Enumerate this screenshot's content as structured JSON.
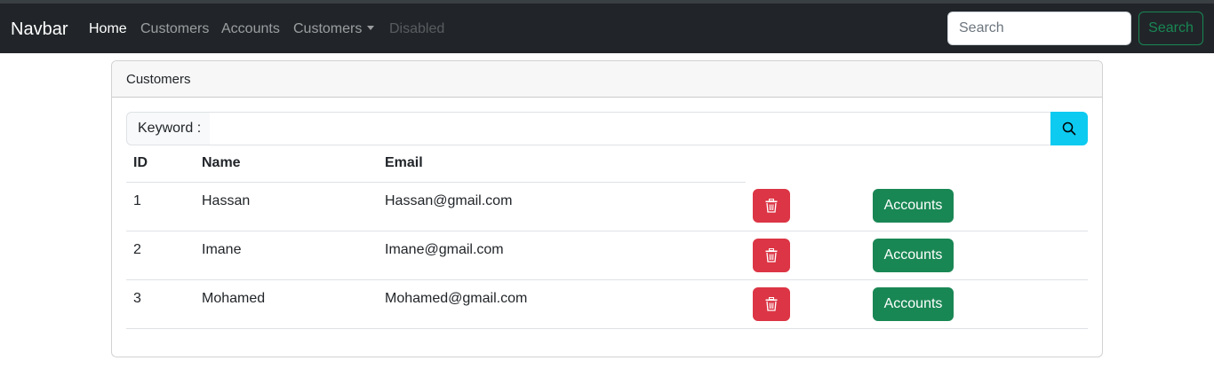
{
  "navbar": {
    "brand": "Navbar",
    "links": [
      {
        "label": "Home",
        "state": "active"
      },
      {
        "label": "Customers",
        "state": "normal"
      },
      {
        "label": "Accounts",
        "state": "normal"
      },
      {
        "label": "Customers",
        "state": "dropdown"
      },
      {
        "label": "Disabled",
        "state": "disabled"
      }
    ],
    "search_placeholder": "Search",
    "search_button": "Search"
  },
  "card": {
    "header": "Customers",
    "keyword_label": "Keyword :",
    "keyword_value": "",
    "search_icon": "search-icon",
    "columns": [
      "ID",
      "Name",
      "Email"
    ],
    "rows": [
      {
        "id": "1",
        "name": "Hassan",
        "email": "Hassan@gmail.com",
        "delete_icon": "trash-icon",
        "accounts_label": "Accounts"
      },
      {
        "id": "2",
        "name": "Imane",
        "email": "Imane@gmail.com",
        "delete_icon": "trash-icon",
        "accounts_label": "Accounts"
      },
      {
        "id": "3",
        "name": "Mohamed",
        "email": "Mohamed@gmail.com",
        "delete_icon": "trash-icon",
        "accounts_label": "Accounts"
      }
    ]
  },
  "colors": {
    "navbar_bg": "#212529",
    "success": "#198754",
    "danger": "#dc3545",
    "info": "#0dcaf0"
  }
}
